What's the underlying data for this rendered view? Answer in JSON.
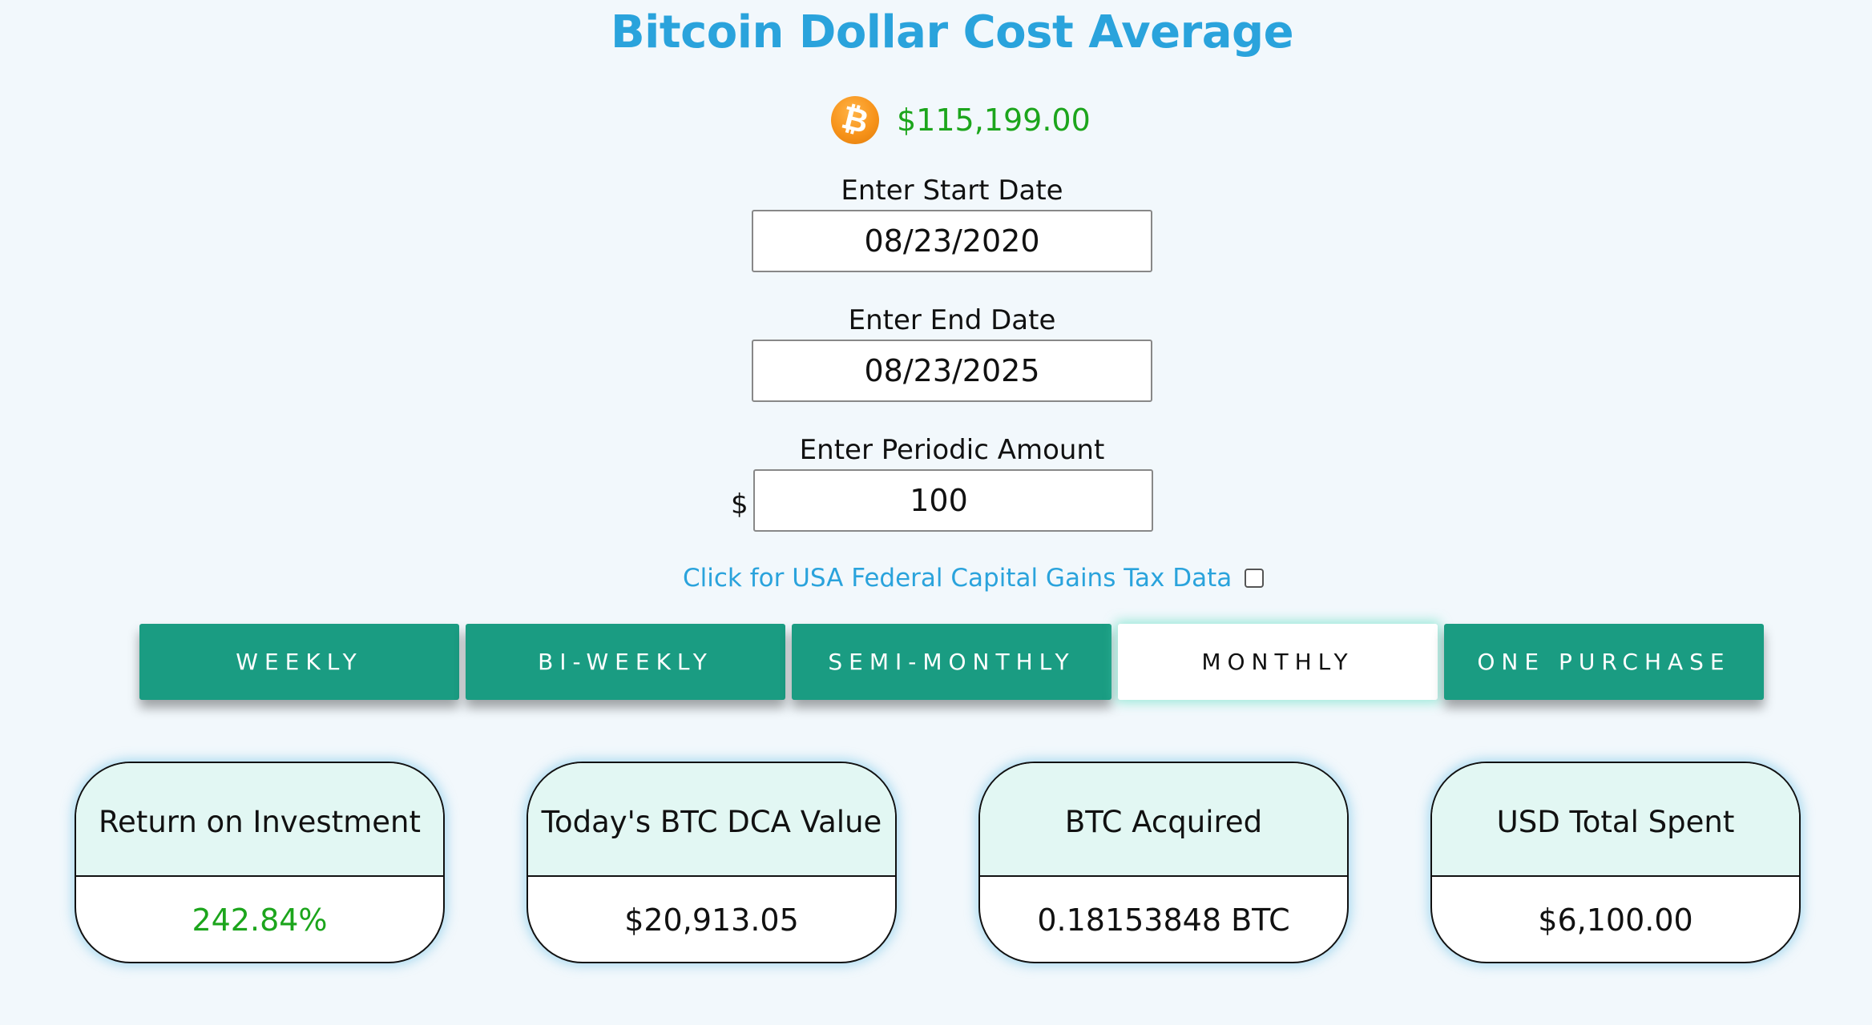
{
  "page": {
    "title": "Bitcoin Dollar Cost Average"
  },
  "price": {
    "icon": "bitcoin-logo-icon",
    "glyph": "₿",
    "value": "$115,199.00",
    "color": "#1ca51c"
  },
  "form": {
    "start_label": "Enter Start Date",
    "start_value": "08/23/2020",
    "end_label": "Enter End Date",
    "end_value": "08/23/2025",
    "amount_label": "Enter Periodic Amount",
    "amount_prefix": "$",
    "amount_value": "100"
  },
  "tax": {
    "label": "Click for USA Federal Capital Gains Tax Data",
    "checked": false
  },
  "frequency": {
    "selected": "MONTHLY",
    "options": [
      "WEEKLY",
      "BI-WEEKLY",
      "SEMI-MONTHLY",
      "MONTHLY",
      "ONE PURCHASE"
    ]
  },
  "results": [
    {
      "label": "Return on Investment",
      "value": "242.84%",
      "color": "#1ca51c"
    },
    {
      "label": "Today's BTC DCA Value",
      "value": "$20,913.05"
    },
    {
      "label": "BTC Acquired",
      "value": "0.18153848 BTC"
    },
    {
      "label": "USD Total Spent",
      "value": "$6,100.00"
    }
  ],
  "colors": {
    "accent": "#2aa3dc",
    "button": "#1a9c82",
    "card_header": "#e2f7f3",
    "background": "#f2f8fc"
  }
}
